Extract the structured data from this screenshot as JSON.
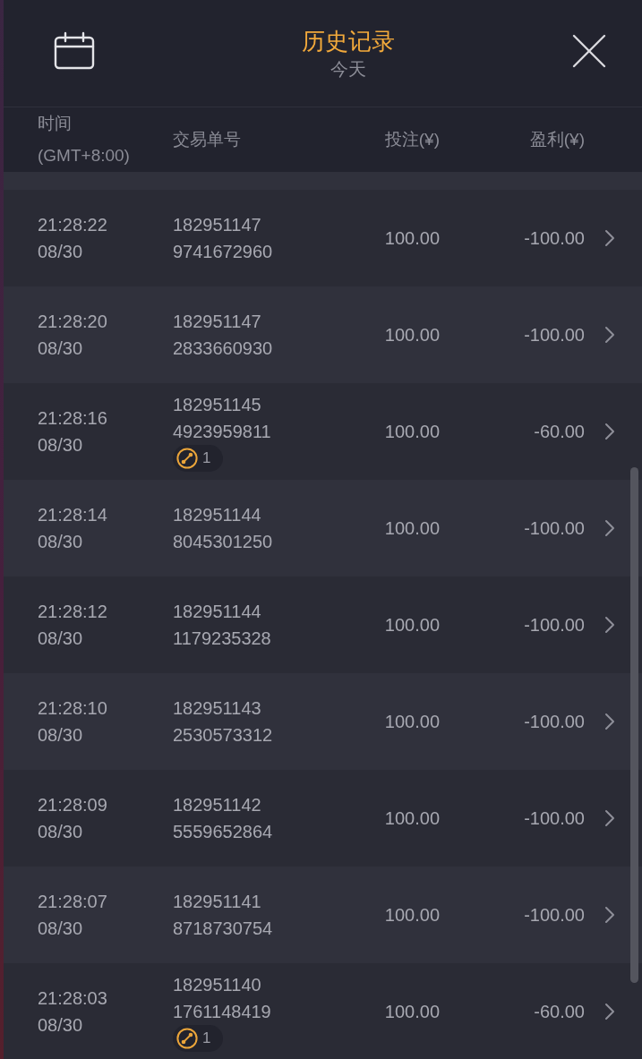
{
  "header": {
    "title": "历史记录",
    "subtitle": "今天"
  },
  "table": {
    "columns": [
      {
        "label": "时间",
        "note": "(GMT+8:00)"
      },
      {
        "label": "交易单号"
      },
      {
        "label": "投注(¥)"
      },
      {
        "label": "盈利(¥)"
      }
    ],
    "rows": [
      {
        "time": "21:28:22",
        "date": "08/30",
        "order_no": [
          "182951147",
          "9741672960"
        ],
        "stake": "100.00",
        "profit": "-100.00"
      },
      {
        "time": "21:28:20",
        "date": "08/30",
        "order_no": [
          "182951147",
          "2833660930"
        ],
        "stake": "100.00",
        "profit": "-100.00"
      },
      {
        "time": "21:28:16",
        "date": "08/30",
        "order_no": [
          "182951145",
          "4923959811"
        ],
        "stake": "100.00",
        "profit": "-60.00",
        "combo_count": "1"
      },
      {
        "time": "21:28:14",
        "date": "08/30",
        "order_no": [
          "182951144",
          "8045301250"
        ],
        "stake": "100.00",
        "profit": "-100.00"
      },
      {
        "time": "21:28:12",
        "date": "08/30",
        "order_no": [
          "182951144",
          "1179235328"
        ],
        "stake": "100.00",
        "profit": "-100.00"
      },
      {
        "time": "21:28:10",
        "date": "08/30",
        "order_no": [
          "182951143",
          "2530573312"
        ],
        "stake": "100.00",
        "profit": "-100.00"
      },
      {
        "time": "21:28:09",
        "date": "08/30",
        "order_no": [
          "182951142",
          "5559652864"
        ],
        "stake": "100.00",
        "profit": "-100.00"
      },
      {
        "time": "21:28:07",
        "date": "08/30",
        "order_no": [
          "182951141",
          "8718730754"
        ],
        "stake": "100.00",
        "profit": "-100.00"
      },
      {
        "time": "21:28:03",
        "date": "08/30",
        "order_no": [
          "182951140",
          "1761148419"
        ],
        "stake": "100.00",
        "profit": "-60.00",
        "combo_count": "1"
      }
    ]
  }
}
